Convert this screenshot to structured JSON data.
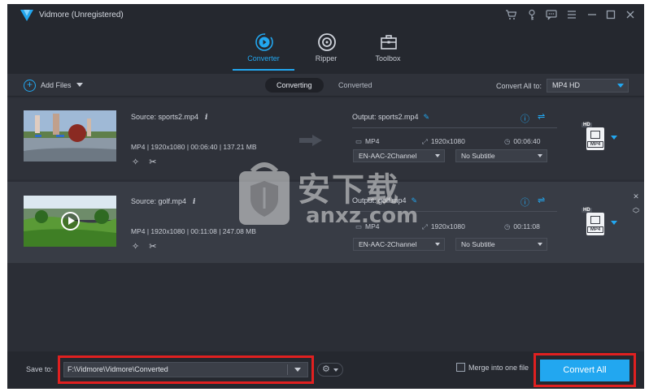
{
  "app": {
    "title": "Vidmore (Unregistered)",
    "accent": "#22a7f0"
  },
  "titlebar_icons": [
    "cart-icon",
    "key-icon",
    "feedback-icon",
    "menu-icon",
    "minimize-icon",
    "maximize-icon",
    "close-icon"
  ],
  "nav": {
    "tabs": [
      {
        "label": "Converter",
        "icon": "converter-icon",
        "active": true
      },
      {
        "label": "Ripper",
        "icon": "disc-icon",
        "active": false
      },
      {
        "label": "Toolbox",
        "icon": "toolbox-icon",
        "active": false
      }
    ]
  },
  "toolbar": {
    "add_files": "Add Files",
    "seg_converting": "Converting",
    "seg_converted": "Converted",
    "convert_all_to_label": "Convert All to:",
    "convert_all_to_value": "MP4 HD"
  },
  "files": [
    {
      "source": "Source: sports2.mp4",
      "meta": "MP4 | 1920x1080 | 00:06:40 | 137.21 MB",
      "output": "Output: sports2.mp4",
      "out_format": "MP4",
      "out_resolution": "1920x1080",
      "out_duration": "00:06:40",
      "audio": "EN-AAC-2Channel",
      "subtitle": "No Subtitle",
      "format_badge": "MP4",
      "hd_badge": "HD"
    },
    {
      "source": "Source: golf.mp4",
      "meta": "MP4 | 1920x1080 | 00:11:08 | 247.08 MB",
      "output": "Output: golf.mp4",
      "out_format": "MP4",
      "out_resolution": "1920x1080",
      "out_duration": "00:11:08",
      "audio": "EN-AAC-2Channel",
      "subtitle": "No Subtitle",
      "format_badge": "MP4",
      "hd_badge": "HD"
    }
  ],
  "watermark": {
    "cn": "安下载",
    "url": "anxz.com"
  },
  "bottom": {
    "save_to_label": "Save to:",
    "save_path": "F:\\Vidmore\\Vidmore\\Converted",
    "merge_label": "Merge into one file",
    "convert_all": "Convert All",
    "highlight_color": "#e02020"
  }
}
